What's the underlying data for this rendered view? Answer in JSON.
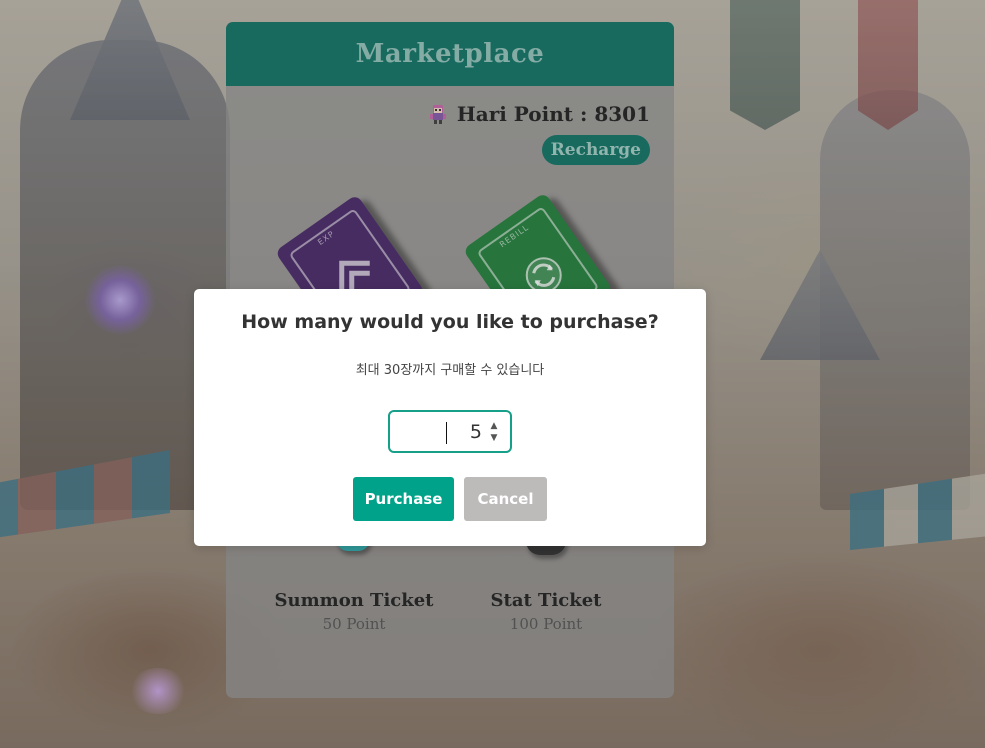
{
  "marketplace": {
    "title": "Marketplace",
    "points_text": "Hari Point : 8301",
    "recharge_label": "Recharge",
    "tickets": [
      {
        "tag": "EXP",
        "icon": "chevron-icon"
      },
      {
        "tag": "REBILL",
        "icon": "refresh-icon"
      }
    ],
    "items": [
      {
        "name": "Summon Ticket",
        "price": "50 Point"
      },
      {
        "name": "Stat Ticket",
        "price": "100 Point"
      }
    ]
  },
  "dialog": {
    "title": "How many would you like to purchase?",
    "subtitle": "최대 30장까지 구매할 수 있습니다",
    "quantity": "5",
    "purchase_label": "Purchase",
    "cancel_label": "Cancel"
  },
  "colors": {
    "header_teal": "#00695c",
    "accent_teal": "#00a38a",
    "cancel_gray": "#bdbaba",
    "exp_ticket": "#3d1a5e",
    "rebill_ticket": "#14772f"
  }
}
